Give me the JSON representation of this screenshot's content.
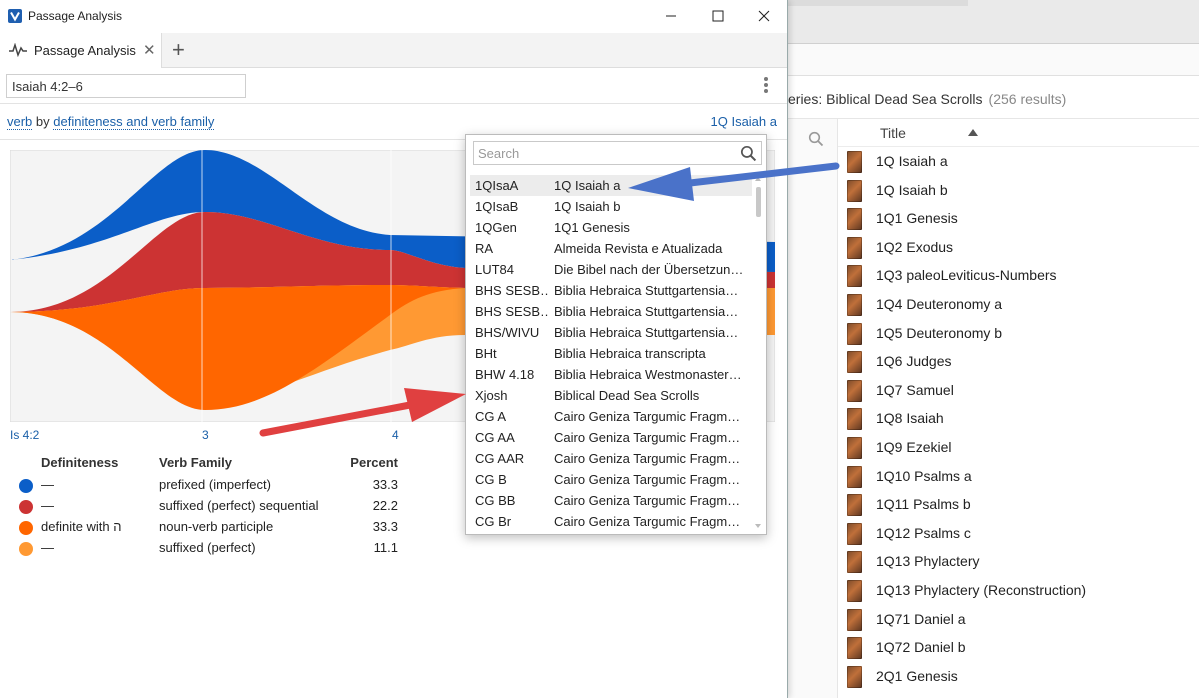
{
  "window": {
    "title": "Passage Analysis"
  },
  "tab": {
    "label": "Passage Analysis",
    "close": "✕",
    "add": "+"
  },
  "toolbar": {
    "reference": "Isaiah 4:2–6"
  },
  "query": {
    "subject": "verb",
    "by": "by",
    "grouping": "definiteness and verb family",
    "resource": "1Q Isaiah a"
  },
  "chart_data": {
    "type": "area",
    "x_ticks": [
      "Is 4:2",
      "3",
      "4"
    ],
    "series": [
      {
        "name": "— / prefixed (imperfect)",
        "color": "#0b5ec8"
      },
      {
        "name": "— / suffixed (perfect) sequential",
        "color": "#cc3333"
      },
      {
        "name": "definite with ה / noun-verb participle",
        "color": "#ff6600"
      },
      {
        "name": "— / suffixed (perfect)",
        "color": "#ff9933"
      }
    ]
  },
  "legend": {
    "headers": {
      "definiteness": "Definiteness",
      "verb_family": "Verb Family",
      "percent": "Percent"
    },
    "rows": [
      {
        "color": "#0b5ec8",
        "definiteness": "—",
        "verb_family": "prefixed (imperfect)",
        "percent": "33.3"
      },
      {
        "color": "#cc3333",
        "definiteness": "—",
        "verb_family": "suffixed (perfect) sequential",
        "percent": "22.2"
      },
      {
        "color": "#ff6600",
        "definiteness": "definite with ה",
        "verb_family": "noun-verb participle",
        "percent": "33.3"
      },
      {
        "color": "#ff9933",
        "definiteness": "—",
        "verb_family": "suffixed (perfect)",
        "percent": "11.1"
      }
    ]
  },
  "popup": {
    "search_placeholder": "Search",
    "items": [
      {
        "abbr": "1QIsaA",
        "title": "1Q Isaiah a",
        "selected": true
      },
      {
        "abbr": "1QIsaB",
        "title": "1Q Isaiah b"
      },
      {
        "abbr": "1QGen",
        "title": "1Q1 Genesis"
      },
      {
        "abbr": "RA",
        "title": "Almeida Revista e Atualizada"
      },
      {
        "abbr": "LUT84",
        "title": "Die Bibel nach der Übersetzun…"
      },
      {
        "abbr": "BHS SESB…",
        "title": "Biblia Hebraica Stuttgartensia…"
      },
      {
        "abbr": "BHS SESB…",
        "title": "Biblia Hebraica Stuttgartensia…"
      },
      {
        "abbr": "BHS/WIVU",
        "title": "Biblia Hebraica Stuttgartensia…"
      },
      {
        "abbr": "BHt",
        "title": "Biblia Hebraica transcripta"
      },
      {
        "abbr": "BHW 4.18",
        "title": "Biblia Hebraica Westmonaster…"
      },
      {
        "abbr": "Xjosh",
        "title": "Biblical Dead Sea Scrolls"
      },
      {
        "abbr": "CG A",
        "title": "Cairo Geniza Targumic Fragm…"
      },
      {
        "abbr": "CG AA",
        "title": "Cairo Geniza Targumic Fragm…"
      },
      {
        "abbr": "CG AAR",
        "title": "Cairo Geniza Targumic Fragm…"
      },
      {
        "abbr": "CG B",
        "title": "Cairo Geniza Targumic Fragm…"
      },
      {
        "abbr": "CG BB",
        "title": "Cairo Geniza Targumic Fragm…"
      },
      {
        "abbr": "CG Br",
        "title": "Cairo Geniza Targumic Fragm…"
      }
    ]
  },
  "background": {
    "header_title": "eries: Biblical Dead Sea Scrolls",
    "header_count": "(256 results)",
    "column_title": "Title",
    "items": [
      "1Q Isaiah a",
      "1Q Isaiah b",
      "1Q1 Genesis",
      "1Q2 Exodus",
      "1Q3 paleoLeviticus-Numbers",
      "1Q4 Deuteronomy a",
      "1Q5 Deuteronomy b",
      "1Q6 Judges",
      "1Q7 Samuel",
      "1Q8 Isaiah",
      "1Q9 Ezekiel",
      "1Q10 Psalms a",
      "1Q11 Psalms b",
      "1Q12 Psalms c",
      "1Q13 Phylactery",
      "1Q13 Phylactery (Reconstruction)",
      "1Q71 Daniel a",
      "1Q72 Daniel b",
      "2Q1 Genesis"
    ]
  },
  "annotations": {
    "arrow_blue_color": "#4a72c9",
    "arrow_red_color": "#e04040"
  }
}
